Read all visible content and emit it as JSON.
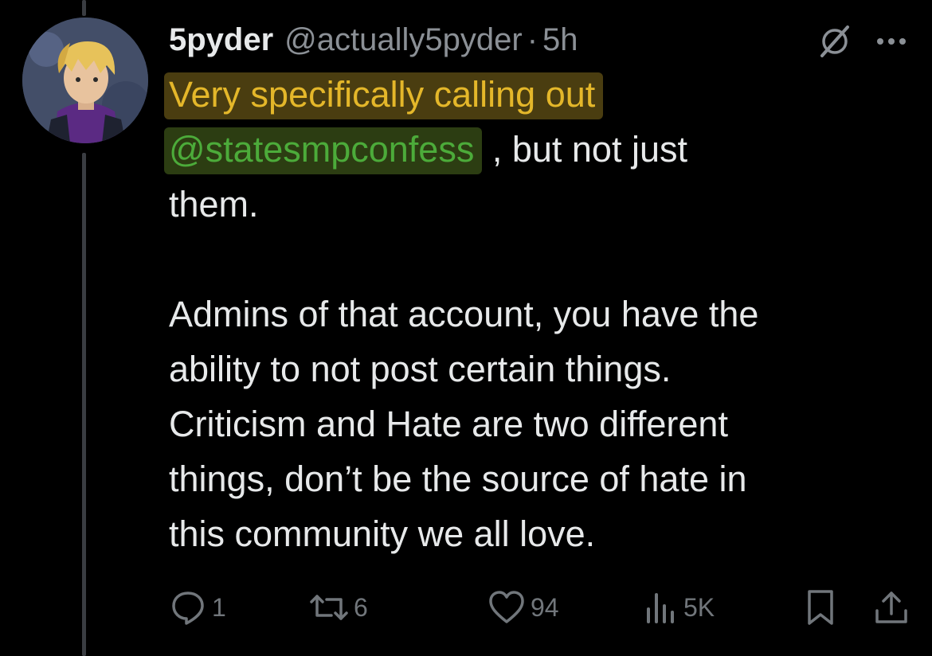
{
  "tweet": {
    "author": {
      "display_name": "5pyder",
      "handle": "@actually5pyder",
      "separator": "·",
      "time": "5h"
    },
    "body": {
      "line1": "Very specifically calling out",
      "mention": "@statesmpconfess",
      "line2_rest": " , but not just",
      "line3": "them.",
      "para2": [
        "Admins of that account, you have the",
        "ability to not post certain things.",
        "Criticism and Hate are two different",
        "things, don’t be the source of hate in",
        "this community we all love."
      ]
    },
    "stats": {
      "replies": "1",
      "reposts": "6",
      "likes": "94",
      "views": "5K"
    }
  },
  "colors": {
    "background": "#000000",
    "text": "#e7e9ea",
    "muted": "#71767b",
    "highlight_yellow": "#e4b72a",
    "highlight_green": "#4cab3a",
    "thread_line": "#3a3d42"
  }
}
